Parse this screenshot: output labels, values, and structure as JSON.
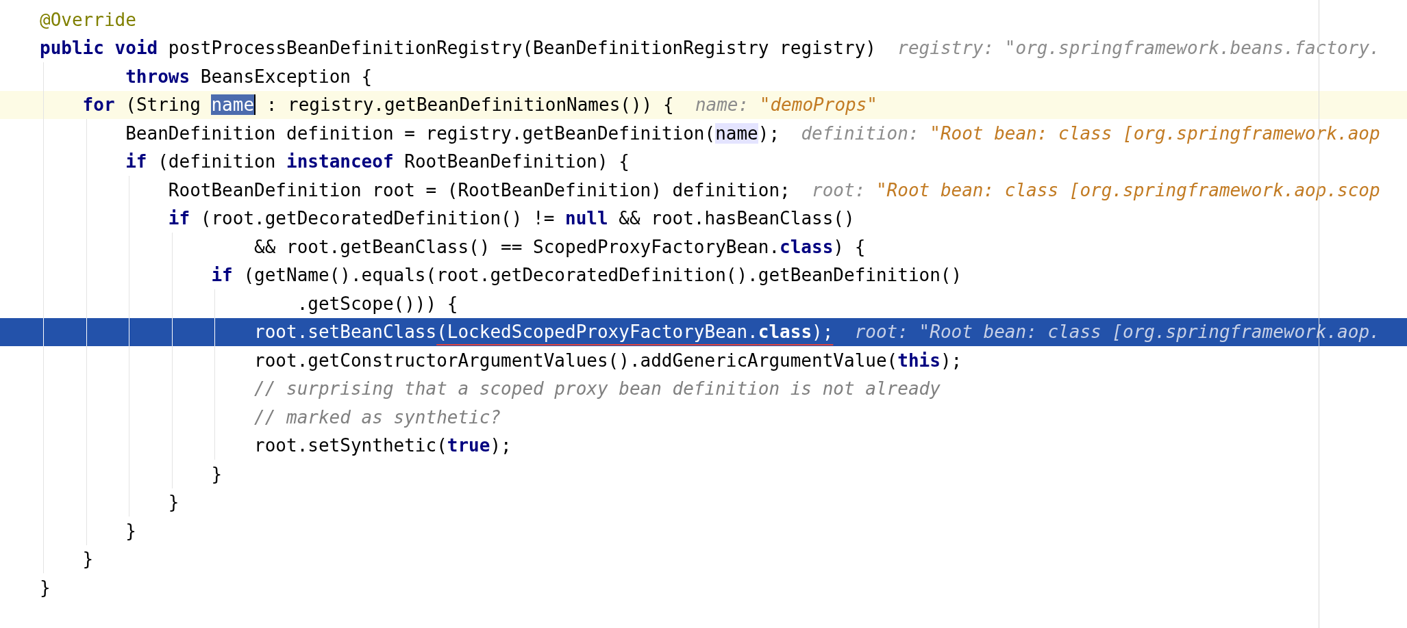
{
  "editor": {
    "lines": [
      {
        "current": false,
        "execution": false,
        "tokens": [
          {
            "kind": "annotation",
            "text": "@Override"
          }
        ]
      },
      {
        "current": false,
        "execution": false,
        "tokens": [
          {
            "kind": "keyword",
            "text": "public"
          },
          {
            "kind": "keyword",
            "text": " void"
          },
          {
            "kind": "plain",
            "text": " postProcessBeanDefinitionRegistry(BeanDefinitionRegistry registry)"
          }
        ],
        "hint": {
          "label": "registry:",
          "value": "\"org.springframework.beans.factory.",
          "kind": "object"
        }
      },
      {
        "current": false,
        "execution": false,
        "continuation": true,
        "tokens": [
          {
            "kind": "keyword",
            "text": "        throws"
          },
          {
            "kind": "plain",
            "text": " BeansException {"
          }
        ]
      },
      {
        "current": true,
        "execution": false,
        "continuation": false,
        "tokens": [
          {
            "kind": "keyword",
            "text": "    for"
          },
          {
            "kind": "plain",
            "text": " (String "
          },
          {
            "kind": "selected",
            "text": "name"
          },
          {
            "kind": "plain",
            "text": " : registry.getBeanDefinitionNames()) {"
          }
        ],
        "hint": {
          "label": "name:",
          "value": "\"demoProps\"",
          "kind": "string"
        }
      },
      {
        "current": false,
        "execution": false,
        "continuation": false,
        "tokens": [
          {
            "kind": "plain",
            "text": "        BeanDefinition definition = registry.getBeanDefinition("
          },
          {
            "kind": "usage",
            "text": "name"
          },
          {
            "kind": "plain",
            "text": ");"
          }
        ],
        "hint": {
          "label": "definition:",
          "value": "\"Root bean: class [org.springframework.aop",
          "kind": "string"
        }
      },
      {
        "current": false,
        "execution": false,
        "continuation": false,
        "tokens": [
          {
            "kind": "keyword",
            "text": "        if"
          },
          {
            "kind": "plain",
            "text": " (definition "
          },
          {
            "kind": "keyword",
            "text": "instanceof"
          },
          {
            "kind": "plain",
            "text": " RootBeanDefinition) {"
          }
        ]
      },
      {
        "current": false,
        "execution": false,
        "continuation": false,
        "tokens": [
          {
            "kind": "plain",
            "text": "            RootBeanDefinition root = (RootBeanDefinition) definition;"
          }
        ],
        "hint": {
          "label": "root:",
          "value": "\"Root bean: class [org.springframework.aop.scop",
          "kind": "string"
        }
      },
      {
        "current": false,
        "execution": false,
        "continuation": false,
        "tokens": [
          {
            "kind": "keyword",
            "text": "            if"
          },
          {
            "kind": "plain",
            "text": " (root.getDecoratedDefinition() != "
          },
          {
            "kind": "keyword",
            "text": "null"
          },
          {
            "kind": "plain",
            "text": " && root.hasBeanClass()"
          }
        ]
      },
      {
        "current": false,
        "execution": false,
        "continuation": true,
        "tokens": [
          {
            "kind": "plain",
            "text": "                    && root.getBeanClass() == ScopedProxyFactoryBean."
          },
          {
            "kind": "keyword",
            "text": "class"
          },
          {
            "kind": "plain",
            "text": ") {"
          }
        ]
      },
      {
        "current": false,
        "execution": false,
        "continuation": false,
        "tokens": [
          {
            "kind": "keyword",
            "text": "                if"
          },
          {
            "kind": "plain",
            "text": " (getName().equals(root.getDecoratedDefinition().getBeanDefinition()"
          }
        ]
      },
      {
        "current": false,
        "execution": false,
        "continuation": true,
        "tokens": [
          {
            "kind": "plain",
            "text": "                        .getScope())) {"
          }
        ]
      },
      {
        "current": false,
        "execution": true,
        "continuation": false,
        "tokens": [
          {
            "kind": "plain",
            "text": "                    root.setBeanClass"
          },
          {
            "kind": "error",
            "tokens": [
              {
                "kind": "plain",
                "text": "(LockedScopedProxyFactoryBean."
              },
              {
                "kind": "keyword",
                "text": "class"
              },
              {
                "kind": "plain",
                "text": ");"
              }
            ]
          }
        ],
        "hint": {
          "label": "root:",
          "value": "\"Root bean: class [org.springframework.aop.",
          "kind": "string"
        }
      },
      {
        "current": false,
        "execution": false,
        "continuation": false,
        "tokens": [
          {
            "kind": "plain",
            "text": "                    root.getConstructorArgumentValues().addGenericArgumentValue("
          },
          {
            "kind": "keyword",
            "text": "this"
          },
          {
            "kind": "plain",
            "text": ");"
          }
        ]
      },
      {
        "current": false,
        "execution": false,
        "continuation": false,
        "tokens": [
          {
            "kind": "comment",
            "text": "                    // surprising that a scoped proxy bean definition is not already"
          }
        ]
      },
      {
        "current": false,
        "execution": false,
        "continuation": false,
        "tokens": [
          {
            "kind": "comment",
            "text": "                    // marked as synthetic?"
          }
        ]
      },
      {
        "current": false,
        "execution": false,
        "continuation": false,
        "tokens": [
          {
            "kind": "plain",
            "text": "                    root.setSynthetic("
          },
          {
            "kind": "keyword",
            "text": "true"
          },
          {
            "kind": "plain",
            "text": ");"
          }
        ]
      },
      {
        "current": false,
        "execution": false,
        "continuation": false,
        "tokens": [
          {
            "kind": "plain",
            "text": "                }"
          }
        ]
      },
      {
        "current": false,
        "execution": false,
        "continuation": false,
        "tokens": [
          {
            "kind": "plain",
            "text": "            }"
          }
        ]
      },
      {
        "current": false,
        "execution": false,
        "continuation": false,
        "tokens": [
          {
            "kind": "plain",
            "text": "        }"
          }
        ]
      },
      {
        "current": false,
        "execution": false,
        "continuation": false,
        "tokens": [
          {
            "kind": "plain",
            "text": "    }"
          }
        ]
      },
      {
        "current": false,
        "execution": false,
        "tokens": [
          {
            "kind": "plain",
            "text": "}"
          }
        ]
      }
    ]
  }
}
